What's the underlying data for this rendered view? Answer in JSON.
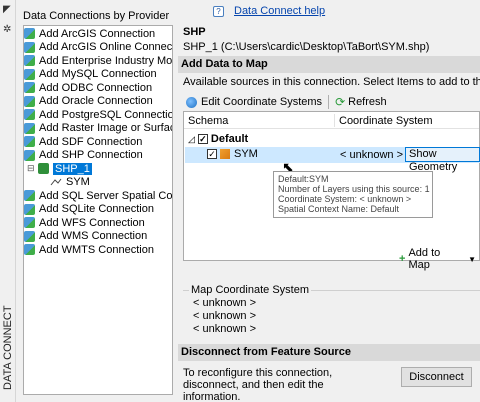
{
  "strip": {
    "label": "DATA CONNECT"
  },
  "providers": {
    "title": "Data Connections by Provider",
    "items": [
      "Add ArcGIS Connection",
      "Add ArcGIS Online Connection",
      "Add Enterprise Industry Model C",
      "Add MySQL Connection",
      "Add ODBC Connection",
      "Add Oracle Connection",
      "Add PostgreSQL Connection",
      "Add Raster Image or Surface Co",
      "Add SDF Connection",
      "Add SHP Connection"
    ],
    "child": "SHP_1",
    "grandchild": "SYM",
    "items_after": [
      "Add SQL Server Spatial Connect",
      "Add SQLite Connection",
      "Add WFS Connection",
      "Add WMS Connection",
      "Add WMTS Connection"
    ]
  },
  "main": {
    "help_link": "Data Connect help",
    "shp_title": "SHP",
    "shp_path": "SHP_1 (C:\\Users\\cardic\\Desktop\\TaBort\\SYM.shp)",
    "add_section": "Add Data to Map",
    "description": "Available sources in this connection.  Select Items to add to the map as lay",
    "toolbar": {
      "edit_cs": "Edit Coordinate Systems",
      "refresh": "Refresh"
    },
    "grid": {
      "col_schema": "Schema",
      "col_cs": "Coordinate System",
      "default_label": "Default",
      "row_name": "SYM",
      "row_cs": "< unknown >",
      "show_geometry": "Show Geometry"
    },
    "tooltip": [
      "Default:SYM",
      "Number of Layers using this source:  1",
      "Coordinate System: < unknown >",
      "Spatial Context Name: Default"
    ],
    "add_to_map": "Add to Map",
    "map_cs": {
      "legend": "Map Coordinate System",
      "values": [
        "< unknown >",
        "< unknown >",
        "< unknown >"
      ]
    },
    "disconnect_section": "Disconnect from Feature Source",
    "disconnect_text": "To reconfigure this connection, disconnect, and then edit the information.",
    "disconnect_button": "Disconnect"
  }
}
